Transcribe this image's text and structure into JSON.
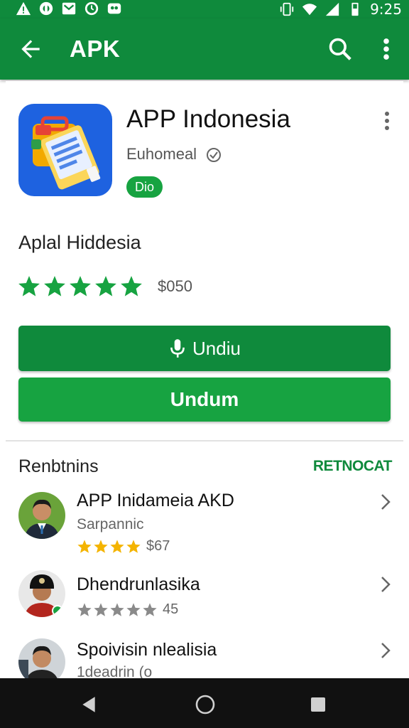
{
  "status_bar": {
    "time": "9:25"
  },
  "app_bar": {
    "title": "APK"
  },
  "app": {
    "name": "APP Indonesia",
    "developer": "Euhomeal",
    "badge": "Dio",
    "subtitle": "Aplal Hiddesia",
    "rating_stars": 5,
    "price": "$050",
    "install_label": "Undiu",
    "secondary_label": "Undum"
  },
  "section": {
    "title": "Renbtnins",
    "action": "REТNOCAT",
    "items": [
      {
        "title": "APP Inidameia AKD",
        "subtitle": "Sarpannic",
        "stars": 4,
        "value": "$67"
      },
      {
        "title": "Dhendrunlasika",
        "stars": 5,
        "value": "45"
      },
      {
        "title": "Spoivisin nlealisia",
        "subtitle": "1deadrin (o"
      }
    ]
  },
  "colors": {
    "primary": "#0f8a3c",
    "accent": "#17a341",
    "star_gold": "#f4b400",
    "star_grey": "#8a8a8a"
  }
}
